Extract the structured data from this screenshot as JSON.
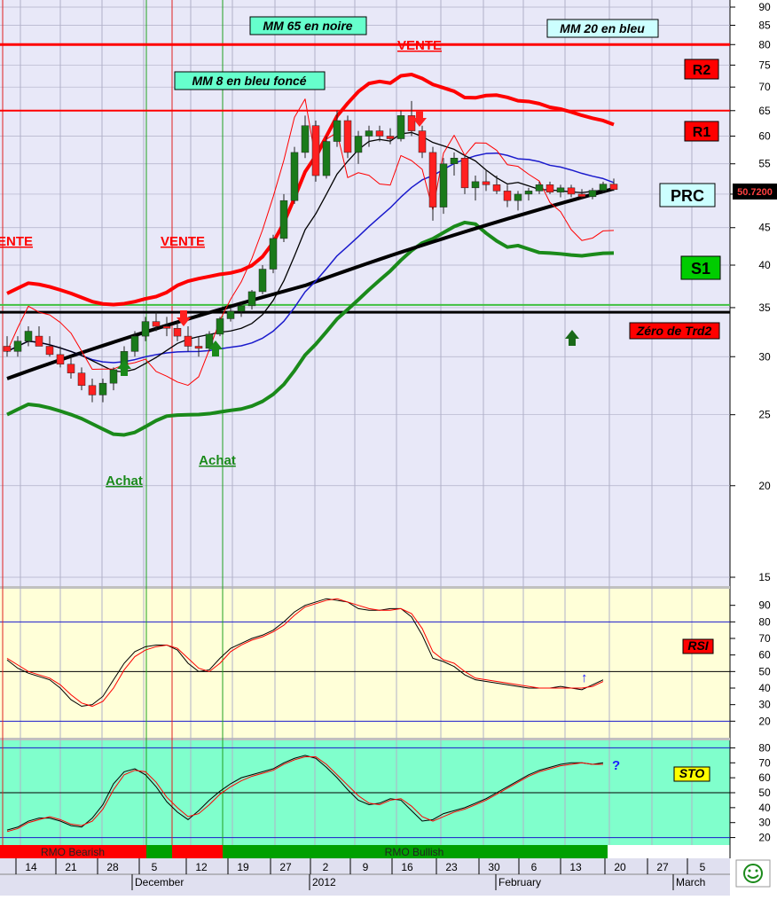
{
  "chart_data": [
    {
      "type": "candlestick",
      "panel": "price",
      "scale": "log",
      "ylim": [
        15,
        90
      ],
      "y_ticks": [
        90,
        85,
        80,
        75,
        70,
        65,
        60,
        55,
        50,
        45,
        40,
        35,
        30,
        25,
        20,
        15
      ],
      "current_price_label": "50.7200",
      "levels": [
        {
          "name": "R2",
          "value": 80,
          "color": "#ff0000"
        },
        {
          "name": "R1",
          "value": 65,
          "color": "#ff0000"
        },
        {
          "name": "PRC",
          "value": 50.72,
          "color": "#ccffff"
        },
        {
          "name": "S1",
          "value": 40,
          "color": "#00cc00"
        },
        {
          "name": "Zéro de Trd2",
          "value": 34.5,
          "color": "#ff0000"
        }
      ],
      "annotations": [
        {
          "text": "MM 65 en noire",
          "color": "#66ffcc"
        },
        {
          "text": "MM 20 en bleu",
          "color": "#ccffff"
        },
        {
          "text": "MM 8 en bleu foncé",
          "color": "#66ffcc"
        },
        {
          "text": "VENTE",
          "kind": "sell"
        },
        {
          "text": "VENTE",
          "kind": "sell"
        },
        {
          "text": "VENTE",
          "kind": "sell"
        },
        {
          "text": "Achat",
          "kind": "buy"
        },
        {
          "text": "Achat",
          "kind": "buy"
        }
      ],
      "candles": [
        {
          "o": 31,
          "h": 32,
          "l": 30,
          "c": 30.5
        },
        {
          "o": 30.5,
          "h": 32,
          "l": 30,
          "c": 31.5
        },
        {
          "o": 31.5,
          "h": 33,
          "l": 31,
          "c": 32.5
        },
        {
          "o": 32,
          "h": 33,
          "l": 31,
          "c": 31
        },
        {
          "o": 31,
          "h": 32,
          "l": 30,
          "c": 30.2
        },
        {
          "o": 30.2,
          "h": 31,
          "l": 29,
          "c": 29.3
        },
        {
          "o": 29.3,
          "h": 30,
          "l": 28,
          "c": 28.5
        },
        {
          "o": 28.5,
          "h": 29,
          "l": 27,
          "c": 27.4
        },
        {
          "o": 27.4,
          "h": 28,
          "l": 26,
          "c": 26.6
        },
        {
          "o": 26.6,
          "h": 28,
          "l": 26,
          "c": 27.6
        },
        {
          "o": 27.6,
          "h": 29,
          "l": 27,
          "c": 28.8
        },
        {
          "o": 28.8,
          "h": 31,
          "l": 28.5,
          "c": 30.5
        },
        {
          "o": 30.5,
          "h": 32.5,
          "l": 30,
          "c": 32
        },
        {
          "o": 32,
          "h": 34,
          "l": 31.5,
          "c": 33.5
        },
        {
          "o": 33.5,
          "h": 34.5,
          "l": 32.5,
          "c": 33
        },
        {
          "o": 33,
          "h": 34,
          "l": 32,
          "c": 32.8
        },
        {
          "o": 32.8,
          "h": 33.5,
          "l": 31.5,
          "c": 32
        },
        {
          "o": 32,
          "h": 33,
          "l": 30.5,
          "c": 31
        },
        {
          "o": 31,
          "h": 32,
          "l": 30,
          "c": 30.8
        },
        {
          "o": 30.8,
          "h": 32.5,
          "l": 30.5,
          "c": 32.2
        },
        {
          "o": 32.2,
          "h": 34,
          "l": 32,
          "c": 33.8
        },
        {
          "o": 33.8,
          "h": 35,
          "l": 33.5,
          "c": 34.6
        },
        {
          "o": 34.6,
          "h": 35.5,
          "l": 34,
          "c": 35.2
        },
        {
          "o": 35.2,
          "h": 37,
          "l": 34.8,
          "c": 36.8
        },
        {
          "o": 36.8,
          "h": 40,
          "l": 36.5,
          "c": 39.5
        },
        {
          "o": 39.5,
          "h": 44,
          "l": 39,
          "c": 43.5
        },
        {
          "o": 43.5,
          "h": 50,
          "l": 43,
          "c": 49
        },
        {
          "o": 49,
          "h": 58,
          "l": 48.5,
          "c": 57
        },
        {
          "o": 57,
          "h": 64,
          "l": 56,
          "c": 62
        },
        {
          "o": 62,
          "h": 63,
          "l": 52,
          "c": 53
        },
        {
          "o": 53,
          "h": 60,
          "l": 52.5,
          "c": 59
        },
        {
          "o": 59,
          "h": 65,
          "l": 58,
          "c": 63
        },
        {
          "o": 63,
          "h": 64,
          "l": 56,
          "c": 57
        },
        {
          "o": 57,
          "h": 61,
          "l": 55,
          "c": 60
        },
        {
          "o": 60,
          "h": 62,
          "l": 58,
          "c": 61
        },
        {
          "o": 61,
          "h": 62,
          "l": 59,
          "c": 60
        },
        {
          "o": 60,
          "h": 61.5,
          "l": 58.5,
          "c": 59.5
        },
        {
          "o": 59.5,
          "h": 65,
          "l": 59,
          "c": 64
        },
        {
          "o": 64,
          "h": 67,
          "l": 60,
          "c": 61
        },
        {
          "o": 61,
          "h": 62,
          "l": 56,
          "c": 57
        },
        {
          "o": 57,
          "h": 58,
          "l": 46,
          "c": 48
        },
        {
          "o": 48,
          "h": 56,
          "l": 47,
          "c": 55
        },
        {
          "o": 55,
          "h": 57,
          "l": 53,
          "c": 56
        },
        {
          "o": 56,
          "h": 56.5,
          "l": 50,
          "c": 51
        },
        {
          "o": 51,
          "h": 53,
          "l": 49,
          "c": 52
        },
        {
          "o": 52,
          "h": 54,
          "l": 50.5,
          "c": 51.5
        },
        {
          "o": 51.5,
          "h": 53,
          "l": 50,
          "c": 50.5
        },
        {
          "o": 50.5,
          "h": 51.5,
          "l": 48,
          "c": 49
        },
        {
          "o": 49,
          "h": 50.5,
          "l": 47.5,
          "c": 50
        },
        {
          "o": 50,
          "h": 51,
          "l": 49,
          "c": 50.5
        },
        {
          "o": 50.5,
          "h": 52,
          "l": 50,
          "c": 51.5
        },
        {
          "o": 51.5,
          "h": 52,
          "l": 50,
          "c": 50.3
        },
        {
          "o": 50.3,
          "h": 51.5,
          "l": 49.5,
          "c": 51
        },
        {
          "o": 51,
          "h": 51.5,
          "l": 49.5,
          "c": 50
        },
        {
          "o": 50,
          "h": 50.8,
          "l": 49.2,
          "c": 49.6
        },
        {
          "o": 49.6,
          "h": 51,
          "l": 49.2,
          "c": 50.6
        },
        {
          "o": 50.6,
          "h": 52,
          "l": 50.2,
          "c": 51.6
        },
        {
          "o": 51.6,
          "h": 52.5,
          "l": 50.5,
          "c": 50.72
        }
      ]
    },
    {
      "type": "line",
      "panel": "RSI",
      "ylim": [
        10,
        100
      ],
      "y_ticks": [
        90,
        80,
        70,
        60,
        50,
        40,
        30,
        20
      ],
      "bands": [
        80,
        50,
        20
      ],
      "label": "RSI",
      "signal_mark": "↑",
      "series": [
        {
          "values": [
            57,
            52,
            49,
            47,
            45,
            40,
            33,
            29,
            30,
            35,
            45,
            55,
            62,
            65,
            66,
            66,
            63,
            55,
            50,
            51,
            58,
            64,
            67,
            70,
            72,
            75,
            80,
            86,
            90,
            92,
            94,
            93,
            92,
            88,
            87,
            87,
            88,
            88,
            83,
            72,
            58,
            56,
            53,
            48,
            45,
            44,
            43,
            42,
            41,
            40,
            40,
            40,
            41,
            40,
            39,
            42,
            45
          ]
        },
        {
          "values": [
            58,
            54,
            50,
            48,
            46,
            42,
            36,
            31,
            29,
            32,
            40,
            51,
            59,
            63,
            65,
            66,
            64,
            58,
            52,
            50,
            55,
            62,
            66,
            69,
            71,
            74,
            78,
            84,
            89,
            91,
            93,
            94,
            92,
            90,
            88,
            87,
            87,
            88,
            85,
            76,
            62,
            57,
            55,
            50,
            46,
            45,
            44,
            43,
            42,
            41,
            40,
            40,
            40,
            40,
            40,
            41,
            44
          ]
        }
      ]
    },
    {
      "type": "line",
      "panel": "STO",
      "ylim": [
        15,
        85
      ],
      "y_ticks": [
        80,
        70,
        60,
        50,
        40,
        30,
        20
      ],
      "bands": [
        80,
        50,
        20
      ],
      "label": "STO",
      "signal_mark": "?",
      "series": [
        {
          "values": [
            25,
            27,
            31,
            33,
            33,
            31,
            28,
            27,
            33,
            42,
            56,
            64,
            66,
            62,
            54,
            44,
            37,
            32,
            38,
            45,
            51,
            56,
            60,
            62,
            64,
            66,
            70,
            73,
            75,
            73,
            67,
            60,
            52,
            45,
            42,
            43,
            46,
            45,
            38,
            31,
            32,
            36,
            38,
            40,
            43,
            46,
            50,
            54,
            58,
            62,
            65,
            67,
            69,
            70,
            70,
            69,
            70
          ]
        },
        {
          "values": [
            24,
            26,
            30,
            32,
            34,
            32,
            29,
            28,
            31,
            39,
            52,
            62,
            65,
            64,
            57,
            47,
            40,
            34,
            36,
            42,
            49,
            54,
            58,
            61,
            63,
            65,
            69,
            72,
            74,
            74,
            69,
            62,
            55,
            48,
            43,
            42,
            45,
            46,
            41,
            34,
            31,
            34,
            37,
            39,
            42,
            45,
            49,
            53,
            57,
            61,
            64,
            66,
            68,
            69,
            70,
            69,
            69
          ]
        }
      ]
    }
  ],
  "xaxis": {
    "day_ticks": [
      "14",
      "21",
      "28",
      "5",
      "12",
      "19",
      "27",
      "2",
      "9",
      "16",
      "23",
      "30",
      "6",
      "13",
      "20",
      "27",
      "5"
    ],
    "month_labels": [
      "December",
      "2012",
      "February",
      "March"
    ]
  },
  "rmo_strip": [
    {
      "label": "RMO Bearish",
      "color": "#ff0000"
    },
    {
      "label": "",
      "color": "#00a000"
    },
    {
      "label": "",
      "color": "#ff0000"
    },
    {
      "label": "RMO Bullish",
      "color": "#00a000"
    }
  ],
  "colors": {
    "price_bg": "#e8e8f8",
    "rsi_bg": "#ffffd8",
    "sto_bg": "#80ffcc",
    "bull": "#1a7a1a",
    "bear": "#ff2020",
    "mm65": "#000000",
    "mm20": "#1a1acc",
    "mm8": "#000000"
  },
  "status_icon": "smiley-icon"
}
